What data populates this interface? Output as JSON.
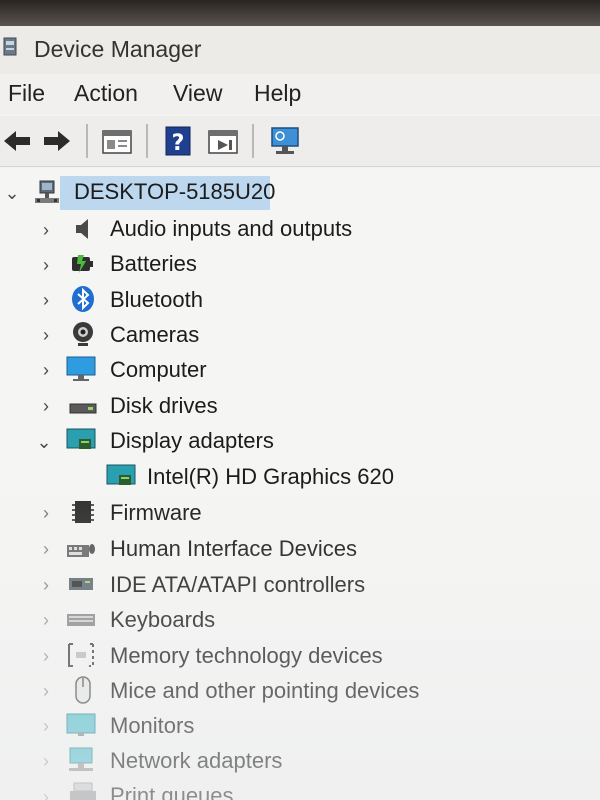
{
  "window": {
    "title": "Device Manager"
  },
  "menu": [
    "File",
    "Action",
    "View",
    "Help"
  ],
  "toolbar": [
    {
      "icon": "back-arrow-icon"
    },
    {
      "icon": "forward-arrow-icon"
    },
    {
      "icon": "properties-icon"
    },
    {
      "icon": "help-icon"
    },
    {
      "icon": "run-icon"
    },
    {
      "icon": "monitor-scan-icon"
    }
  ],
  "tree": {
    "root": {
      "label": "DESKTOP-5185U20",
      "expanded": true,
      "icon": "computer-network-icon"
    },
    "items": [
      {
        "label": "Audio inputs and outputs",
        "icon": "speaker-icon",
        "expanded": false
      },
      {
        "label": "Batteries",
        "icon": "battery-icon",
        "expanded": false
      },
      {
        "label": "Bluetooth",
        "icon": "bluetooth-icon",
        "expanded": false
      },
      {
        "label": "Cameras",
        "icon": "camera-icon",
        "expanded": false
      },
      {
        "label": "Computer",
        "icon": "monitor-icon",
        "expanded": false
      },
      {
        "label": "Disk drives",
        "icon": "disk-drive-icon",
        "expanded": false
      },
      {
        "label": "Display adapters",
        "icon": "display-adapter-icon",
        "expanded": true
      },
      {
        "label": "Intel(R) HD Graphics 620",
        "icon": "display-adapter-icon",
        "child": true
      },
      {
        "label": "Firmware",
        "icon": "firmware-icon",
        "expanded": false
      },
      {
        "label": "Human Interface Devices",
        "icon": "hid-icon",
        "expanded": false
      },
      {
        "label": "IDE ATA/ATAPI controllers",
        "icon": "ide-controller-icon",
        "expanded": false
      },
      {
        "label": "Keyboards",
        "icon": "keyboard-icon",
        "expanded": false
      },
      {
        "label": "Memory technology devices",
        "icon": "memory-icon",
        "expanded": false
      },
      {
        "label": "Mice and other pointing devices",
        "icon": "mouse-icon",
        "expanded": false
      },
      {
        "label": "Monitors",
        "icon": "monitor-icon",
        "expanded": false
      },
      {
        "label": "Network adapters",
        "icon": "network-adapter-icon",
        "expanded": false
      },
      {
        "label": "Print queues",
        "icon": "printer-icon",
        "expanded": false
      }
    ]
  },
  "colors": {
    "selection": "#bcd7ee",
    "accent": "#1f6fd1"
  }
}
